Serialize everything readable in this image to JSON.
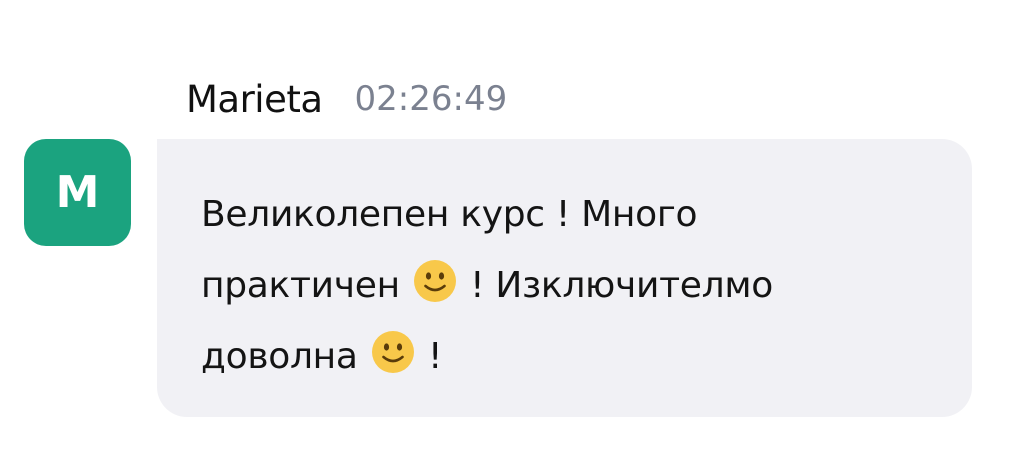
{
  "message": {
    "avatar_initial": "M",
    "avatar_color": "#1ba37f",
    "author": "Marieta",
    "timestamp": "02:26:49",
    "text": {
      "line1": "Великолепен курс ! Много",
      "line2_a": "практичен",
      "line2_b": "! Изключителмо",
      "line3_a": "доволна",
      "line3_b": "!"
    },
    "emoji": "slightly-smiling-face-icon"
  }
}
